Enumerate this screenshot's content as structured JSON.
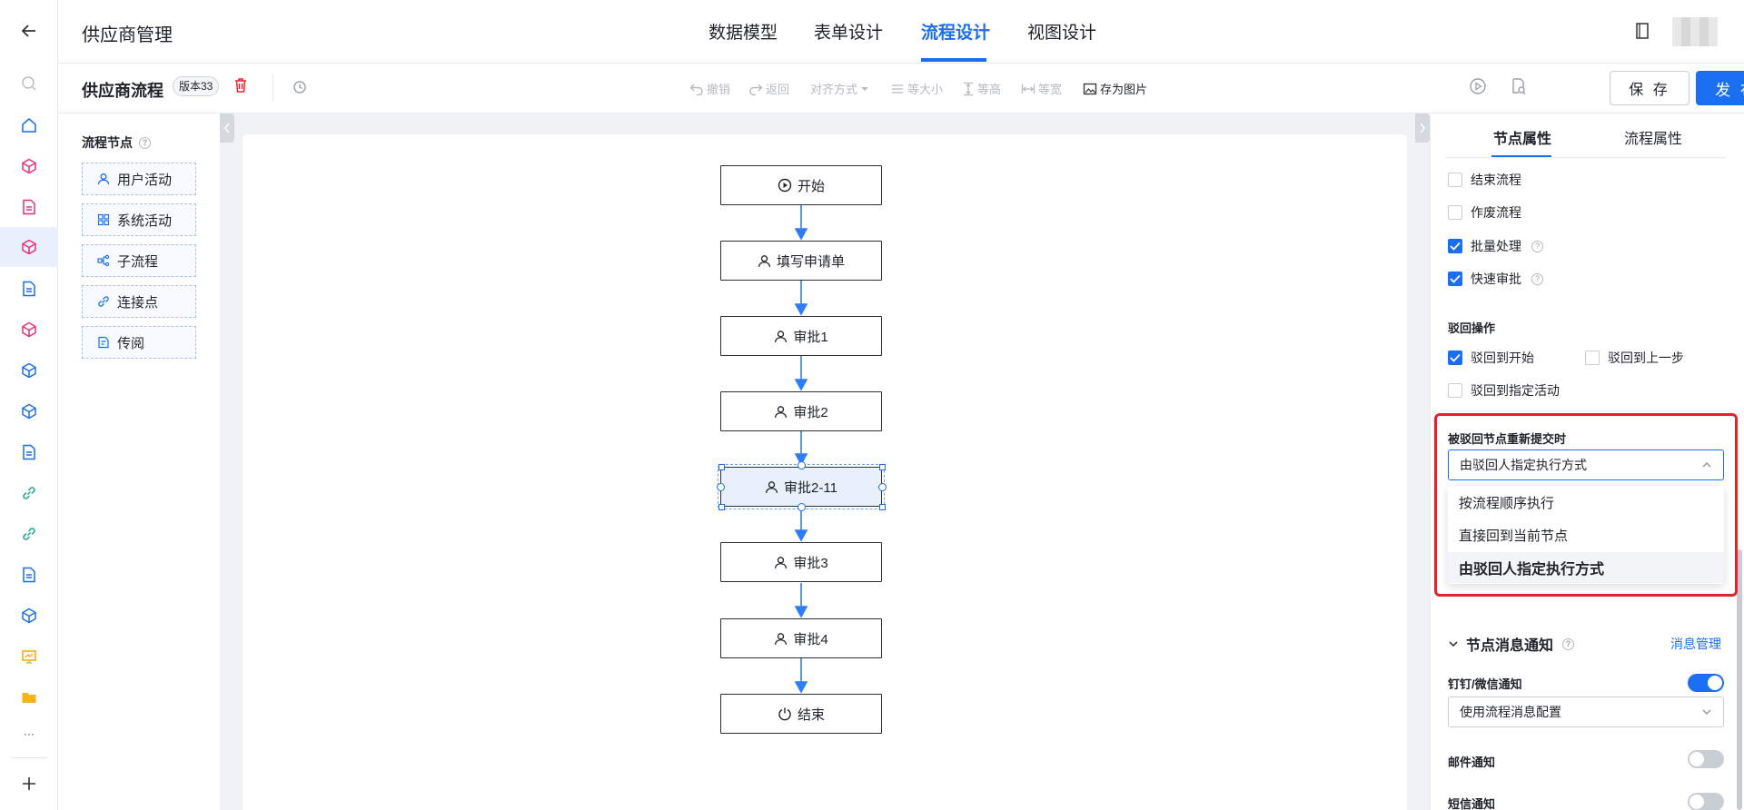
{
  "app": {
    "title": "供应商管理",
    "back_icon": "arrow-left-icon"
  },
  "nav_tabs": [
    {
      "label": "数据模型",
      "active": false
    },
    {
      "label": "表单设计",
      "active": false
    },
    {
      "label": "流程设计",
      "active": true
    },
    {
      "label": "视图设计",
      "active": false
    }
  ],
  "rail": {
    "icons": [
      "search-icon",
      "home-icon",
      "cube-icon",
      "document-icon",
      "cube-icon",
      "document-icon",
      "cube-icon",
      "cube-icon",
      "cube-icon",
      "document-icon",
      "link-icon",
      "link-icon",
      "document-icon",
      "cube-icon",
      "monitor-icon",
      "folder-icon",
      "more-icon",
      "plus-icon"
    ],
    "more": "···"
  },
  "toolbar": {
    "flow_title": "供应商流程",
    "version": "版本33",
    "undo": "撤销",
    "redo": "返回",
    "align": "对齐方式",
    "same_size": "等大小",
    "same_height": "等高",
    "same_width": "等宽",
    "save_image": "存为图片",
    "save": "保 存",
    "publish": "发 布"
  },
  "palette": {
    "title": "流程节点",
    "items": [
      {
        "label": "用户活动",
        "icon": "user-icon"
      },
      {
        "label": "系统活动",
        "icon": "grid-icon"
      },
      {
        "label": "子流程",
        "icon": "subflow-icon"
      },
      {
        "label": "连接点",
        "icon": "link-icon"
      },
      {
        "label": "传阅",
        "icon": "circulate-icon"
      }
    ]
  },
  "flow": {
    "nodes": [
      {
        "label": "开始",
        "icon": "play-circle-icon"
      },
      {
        "label": "填写申请单",
        "icon": "user-icon"
      },
      {
        "label": "审批1",
        "icon": "user-icon"
      },
      {
        "label": "审批2",
        "icon": "user-icon"
      },
      {
        "label": "审批2-11",
        "icon": "user-icon",
        "selected": true
      },
      {
        "label": "审批3",
        "icon": "user-icon"
      },
      {
        "label": "审批4",
        "icon": "user-icon"
      },
      {
        "label": "结束",
        "icon": "power-icon"
      }
    ]
  },
  "props": {
    "tabs": [
      {
        "label": "节点属性",
        "active": true
      },
      {
        "label": "流程属性",
        "active": false
      }
    ],
    "checkboxes": [
      {
        "label": "结束流程",
        "checked": false
      },
      {
        "label": "作废流程",
        "checked": false
      },
      {
        "label": "批量处理",
        "checked": true,
        "help": true
      },
      {
        "label": "快速审批",
        "checked": true,
        "help": true
      }
    ],
    "reject_section": "驳回操作",
    "reject_options": [
      {
        "label": "驳回到开始",
        "checked": true
      },
      {
        "label": "驳回到上一步",
        "checked": false
      },
      {
        "label": "驳回到指定活动",
        "checked": false
      }
    ],
    "resubmit_label": "被驳回节点重新提交时",
    "resubmit_value": "由驳回人指定执行方式",
    "dropdown_options": [
      {
        "label": "按流程顺序执行",
        "selected": false
      },
      {
        "label": "直接回到当前节点",
        "selected": false
      },
      {
        "label": "由驳回人指定执行方式",
        "selected": true
      }
    ],
    "notify_title": "节点消息通知",
    "msg_manage": "消息管理",
    "dingtalk_label": "钉钉/微信通知",
    "dingtalk_on": true,
    "dingtalk_select": "使用流程消息配置",
    "email_label": "邮件通知",
    "email_on": false,
    "sms_label": "短信通知",
    "sms_on": false
  },
  "colors": {
    "accent": "#1a6ff0",
    "highlight": "#e4242b"
  }
}
